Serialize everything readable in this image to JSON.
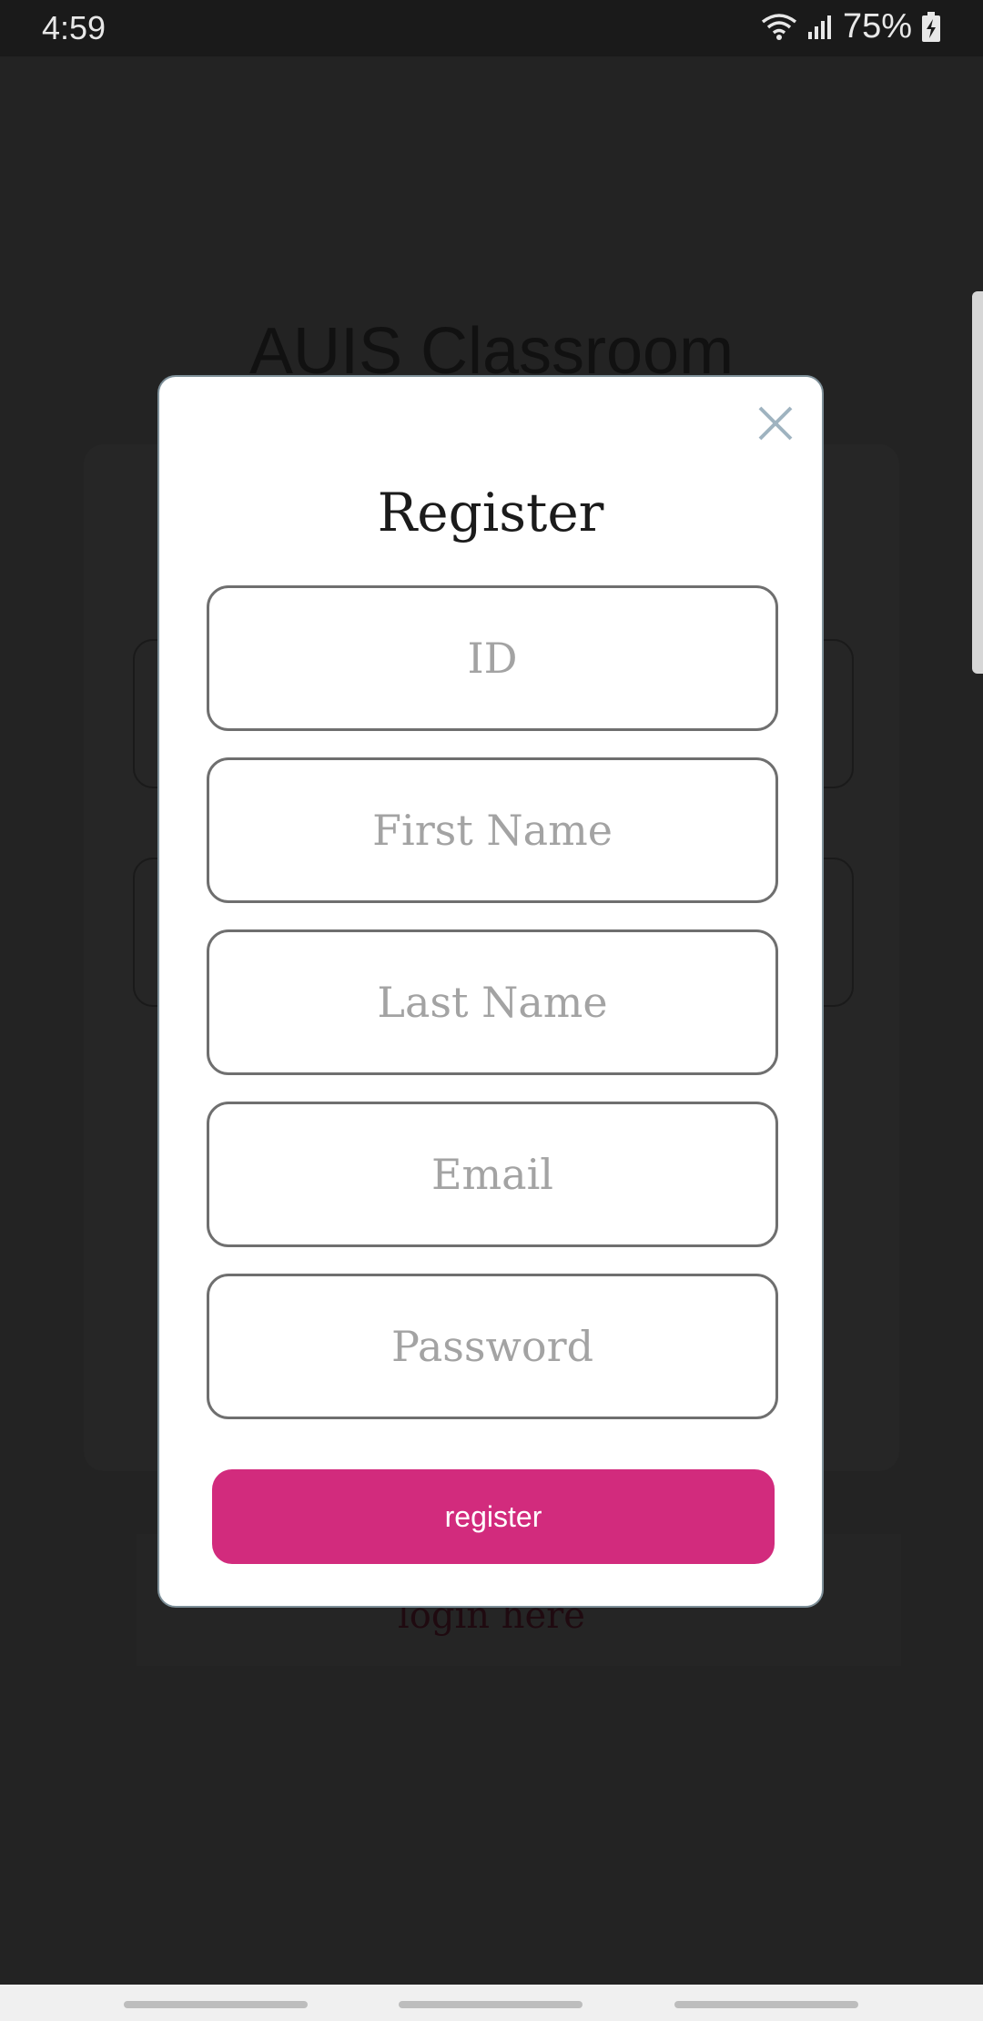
{
  "status_bar": {
    "time": "4:59",
    "battery_percent": "75%",
    "icons": [
      "wifi-icon",
      "signal-icon",
      "battery-charging-icon"
    ]
  },
  "background": {
    "app_title": "AUIS Classroom",
    "link": "login here"
  },
  "modal": {
    "title": "Register",
    "close_icon": "close-icon",
    "fields": {
      "id_placeholder": "ID",
      "first_name_placeholder": "First Name",
      "last_name_placeholder": "Last Name",
      "email_placeholder": "Email",
      "password_placeholder": "Password"
    },
    "register_label": "register"
  },
  "colors": {
    "accent": "#d22b7d",
    "overlay": "#232323",
    "field_border": "#6f6f6f",
    "placeholder": "#a3a3a3"
  }
}
